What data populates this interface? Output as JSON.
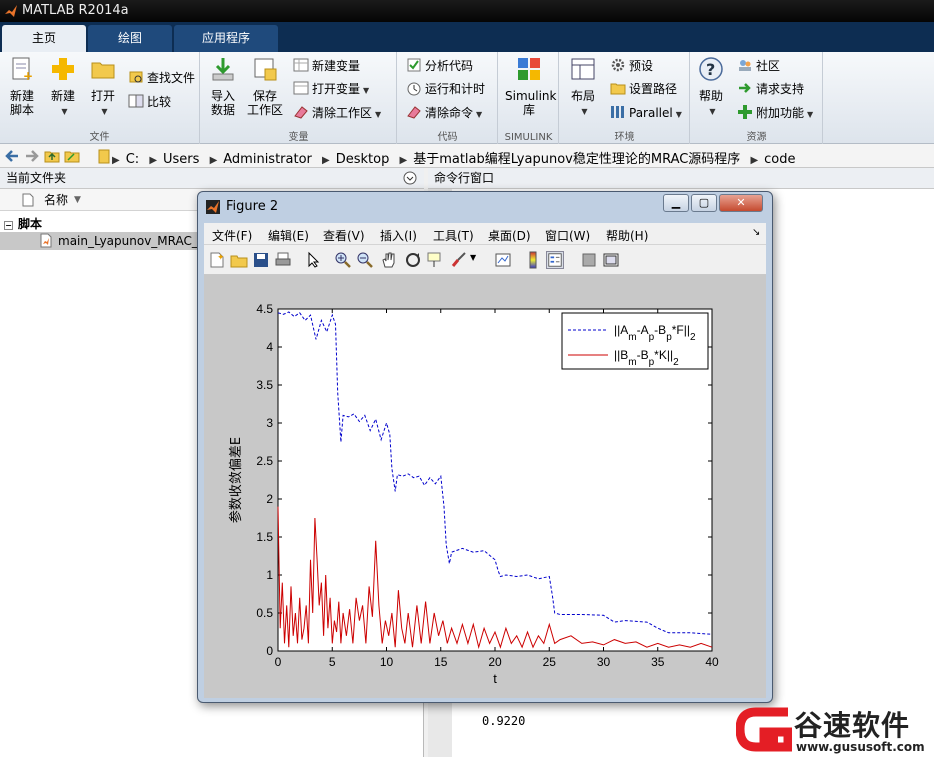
{
  "app": {
    "title": "MATLAB R2014a"
  },
  "tabs": [
    {
      "label": "主页"
    },
    {
      "label": "绘图"
    },
    {
      "label": "应用程序"
    }
  ],
  "ribbon": {
    "file_group": {
      "label": "文件",
      "new_script": "新建\n脚本",
      "new": "新建",
      "open": "打开",
      "find_files": "查找文件",
      "compare": "比较"
    },
    "variable_group": {
      "label": "变量",
      "import": "导入\n数据",
      "save_ws": "保存\n工作区",
      "new_var": "新建变量",
      "open_var": "打开变量",
      "clear_ws": "清除工作区"
    },
    "code_group": {
      "label": "代码",
      "analyze": "分析代码",
      "run_time": "运行和计时",
      "clear_cmd": "清除命令"
    },
    "simulink_group": {
      "label": "SIMULINK",
      "simulink": "Simulink\n库"
    },
    "env_group": {
      "label": "环境",
      "layout": "布局",
      "prefs": "预设",
      "set_path": "设置路径",
      "parallel": "Parallel"
    },
    "res_group": {
      "label": "资源",
      "help": "帮助",
      "community": "社区",
      "support": "请求支持",
      "addons": "附加功能"
    }
  },
  "address": {
    "crumbs": [
      "C:",
      "Users",
      "Administrator",
      "Desktop",
      "基于matlab编程Lyapunov稳定性理论的MRAC源码程序",
      "code"
    ]
  },
  "left_panel": {
    "title": "当前文件夹",
    "col_name": "名称",
    "group": "脚本",
    "file": "main_Lyapunov_MRAC_"
  },
  "right_panel": {
    "title": "命令行窗口",
    "output": "0.9220"
  },
  "figure": {
    "title": "Figure 2",
    "menus": [
      "文件(F)",
      "编辑(E)",
      "查看(V)",
      "插入(I)",
      "工具(T)",
      "桌面(D)",
      "窗口(W)",
      "帮助(H)"
    ]
  },
  "chart_data": {
    "type": "line",
    "xlabel": "t",
    "ylabel": "参数收敛偏差E",
    "xlim": [
      0,
      40
    ],
    "ylim": [
      0,
      4.5
    ],
    "xticks": [
      "0",
      "5",
      "10",
      "15",
      "20",
      "25",
      "30",
      "35",
      "40"
    ],
    "yticks": [
      "0",
      "0.5",
      "1",
      "1.5",
      "2",
      "2.5",
      "3",
      "3.5",
      "4",
      "4.5"
    ],
    "legend_position": "top-right",
    "series": [
      {
        "name": "||Am-Ap-Bp*F||2",
        "style": "dashed",
        "color": "#0000cc",
        "x": [
          0,
          0.5,
          1,
          1.5,
          2,
          2.5,
          3,
          3.5,
          4,
          4.5,
          5,
          5.3,
          5.5,
          5.8,
          6,
          6.5,
          7,
          7.5,
          8,
          8.5,
          9,
          9.5,
          10,
          10.3,
          10.5,
          10.8,
          11,
          11.5,
          12,
          12.5,
          13,
          13.5,
          14,
          14.5,
          15,
          15.3,
          15.5,
          15.8,
          16,
          17,
          18,
          19,
          20,
          20.3,
          20.5,
          21,
          22,
          23,
          24,
          25,
          25.3,
          25.5,
          26,
          28,
          30,
          31,
          32,
          34,
          35,
          36,
          38,
          40
        ],
        "values": [
          4.45,
          4.43,
          4.46,
          4.4,
          4.45,
          4.35,
          4.42,
          4.1,
          4.35,
          4.2,
          4.42,
          4.3,
          3.4,
          2.75,
          3.1,
          3.08,
          3.12,
          3.02,
          3.1,
          2.9,
          3.05,
          2.78,
          3.0,
          2.85,
          2.4,
          2.1,
          2.32,
          2.3,
          2.33,
          2.28,
          2.3,
          2.18,
          2.28,
          2.2,
          2.3,
          1.9,
          1.4,
          1.15,
          1.3,
          1.35,
          1.3,
          1.32,
          1.2,
          1.05,
          0.98,
          1.0,
          0.98,
          1.0,
          0.95,
          0.98,
          0.72,
          0.5,
          0.48,
          0.48,
          0.47,
          0.38,
          0.4,
          0.38,
          0.3,
          0.24,
          0.24,
          0.22
        ]
      },
      {
        "name": "||Bm-Bp*K||2",
        "style": "solid",
        "color": "#cc0000",
        "x": [
          0,
          0.2,
          0.4,
          0.6,
          0.8,
          1,
          1.2,
          1.4,
          1.6,
          1.8,
          2,
          2.2,
          2.4,
          2.6,
          2.8,
          3,
          3.2,
          3.4,
          3.6,
          3.8,
          4,
          4.2,
          4.4,
          4.6,
          4.8,
          5,
          5.2,
          5.4,
          5.6,
          5.8,
          6,
          6.3,
          6.6,
          6.9,
          7.2,
          7.5,
          7.8,
          8.1,
          8.4,
          8.7,
          9,
          9.3,
          9.6,
          9.9,
          10.2,
          10.5,
          10.8,
          11.1,
          11.4,
          11.7,
          12,
          12.4,
          12.8,
          13.2,
          13.6,
          14,
          14.4,
          14.8,
          15.2,
          15.6,
          16,
          16.5,
          17,
          17.5,
          18,
          18.5,
          19,
          19.5,
          20,
          20.5,
          21,
          21.5,
          22,
          22.5,
          23,
          23.5,
          24,
          24.5,
          25,
          25.5,
          26,
          27,
          28,
          29,
          30,
          31,
          32,
          33,
          34,
          35,
          36,
          37,
          38,
          39,
          40
        ],
        "values": [
          1.9,
          0.3,
          0.9,
          0.1,
          0.6,
          0.05,
          0.85,
          0.2,
          0.5,
          0.1,
          0.7,
          0.15,
          0.3,
          0.6,
          0.1,
          1.2,
          0.5,
          1.75,
          1.2,
          0.6,
          0.9,
          0.2,
          1.0,
          0.3,
          0.7,
          0.1,
          0.4,
          0.25,
          0.65,
          0.1,
          0.5,
          0.2,
          0.55,
          0.1,
          0.7,
          0.4,
          0.6,
          0.1,
          0.85,
          0.45,
          1.45,
          0.6,
          0.1,
          0.4,
          0.2,
          0.5,
          0.05,
          0.8,
          0.3,
          0.1,
          0.5,
          0.05,
          0.6,
          0.1,
          0.65,
          0.1,
          0.5,
          0.2,
          0.4,
          0.1,
          0.3,
          0.1,
          0.35,
          0.1,
          0.35,
          0.05,
          0.3,
          0.1,
          0.25,
          0.05,
          0.3,
          0.1,
          0.2,
          0.05,
          0.25,
          0.05,
          0.2,
          0.1,
          0.35,
          0.1,
          0.15,
          0.2,
          0.1,
          0.12,
          0.08,
          0.15,
          0.1,
          0.12,
          0.05,
          0.1,
          0.05,
          0.08,
          0.05,
          0.1,
          0.05
        ]
      }
    ]
  },
  "watermark": {
    "text": "谷速软件",
    "url": "www.gususoft.com"
  }
}
